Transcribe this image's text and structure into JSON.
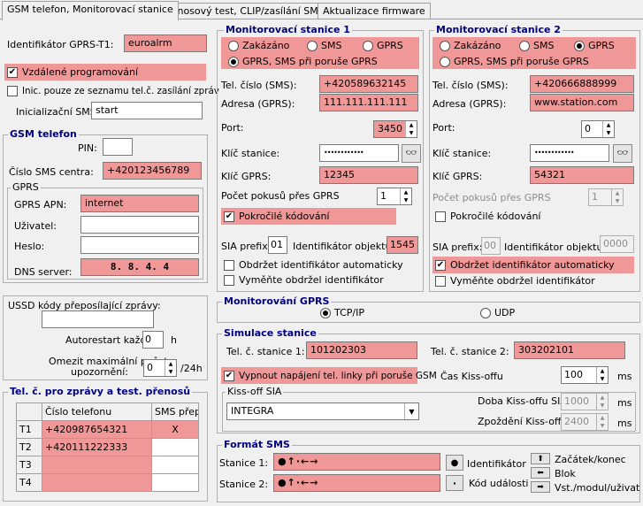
{
  "tabs": [
    {
      "label": "GSM telefon, Monitorovací stanice"
    },
    {
      "label": "Přenosový test, CLIP/zasílání SMS"
    },
    {
      "label": "Aktualizace firmware"
    }
  ],
  "gprs_id": {
    "label": "Identifikátor GPRS-T1:",
    "value": "euroalrm"
  },
  "remote_prog": {
    "label": "Vzdálené programování"
  },
  "init_only": {
    "label": "Inic. pouze ze seznamu tel.č. zasílání zpráv"
  },
  "init_sms": {
    "label": "Inicializační SMS:",
    "value": "start"
  },
  "gsm": {
    "title": "GSM telefon",
    "pin_label": "PIN:",
    "pin_value": "",
    "sms_center_label": "Číslo SMS centra:",
    "sms_center_value": "+420123456789",
    "gprs_title": "GPRS",
    "apn_label": "GPRS APN:",
    "apn_value": "internet",
    "user_label": "Uživatel:",
    "user_value": "",
    "pass_label": "Heslo:",
    "pass_value": "",
    "dns_label": "DNS server:",
    "dns_value": "8.  8.  4.  4"
  },
  "ussd": {
    "label": "USSD kódy přeposílající zprávy:",
    "value": ""
  },
  "autorestart": {
    "label": "Autorestart každé:",
    "value": "0",
    "unit": "h"
  },
  "omit": {
    "label1": "Omezit maximální počet",
    "label2": "upozornění:",
    "value": "0",
    "unit": "/24h"
  },
  "tel_table": {
    "title": "Tel. č. pro zprávy a test. přenosů",
    "headers": [
      "Číslo telefonu",
      "SMS přepo"
    ],
    "rows": [
      {
        "id": "T1",
        "number": "+420987654321",
        "sms": "X"
      },
      {
        "id": "T2",
        "number": "+420111222333",
        "sms": ""
      },
      {
        "id": "T3",
        "number": "",
        "sms": ""
      },
      {
        "id": "T4",
        "number": "",
        "sms": ""
      }
    ]
  },
  "ms1": {
    "title": "Monitorovací stanice 1",
    "opt_disabled": "Zakázáno",
    "opt_sms": "SMS",
    "opt_gprs": "GPRS",
    "opt_both": "GPRS, SMS při poruše GPRS",
    "tel_label": "Tel. číslo (SMS):",
    "tel_value": "+420589632145",
    "addr_label": "Adresa (GPRS):",
    "addr_value": "111.111.111.111",
    "port_label": "Port:",
    "port_value": "3450",
    "key_label": "Klíč stanice:",
    "key_value": "••••••••••••",
    "gkey_label": "Klíč GPRS:",
    "gkey_value": "12345",
    "attempts_label": "Počet pokusů přes GPRS",
    "attempts_value": "1",
    "adv_label": "Pokročilé kódování",
    "sia_label": "SIA prefix:",
    "sia_value": "01",
    "objid_label": "Identifikátor objektu",
    "objid_value": "1545",
    "auto_label": "Obdržet identifikátor automaticky",
    "replace_label": "Vyměňte obdržel identifikátor"
  },
  "ms2": {
    "title": "Monitorovací stanice 2",
    "opt_disabled": "Zakázáno",
    "opt_sms": "SMS",
    "opt_gprs": "GPRS",
    "opt_both": "GPRS, SMS při poruše GPRS",
    "tel_label": "Tel. číslo (SMS):",
    "tel_value": "+420666888999",
    "addr_label": "Adresa (GPRS):",
    "addr_value": "www.station.com",
    "port_label": "Port:",
    "port_value": "0",
    "key_label": "Klíč stanice:",
    "key_value": "••••••••••••",
    "gkey_label": "Klíč GPRS:",
    "gkey_value": "54321",
    "attempts_label": "Počet pokusů přes GPRS",
    "attempts_value": "1",
    "adv_label": "Pokročilé kódování",
    "sia_label": "SIA prefix:",
    "sia_value": "00",
    "objid_label": "Identifikátor objektu",
    "objid_value": "0000",
    "auto_label": "Obdržet identifikátor automaticky",
    "replace_label": "Vyměňte obdržel identifikátor"
  },
  "gprs_mon": {
    "title": "Monitorování GPRS",
    "tcp": "TCP/IP",
    "udp": "UDP"
  },
  "sim": {
    "title": "Simulace stanice",
    "st1_label": "Tel. č. stanice 1:",
    "st1_value": "101202303",
    "st2_label": "Tel. č. stanice 2:",
    "st2_value": "303202101",
    "cutoff_label": "Vypnout napájení tel. linky při poruše GSM",
    "kiss_label": "Čas Kiss-offu",
    "kiss_value": "100",
    "kiss_unit": "ms",
    "kisssia_title": "Kiss-off SIA",
    "kisssia_value": "INTEGRA",
    "dur_label": "Doba Kiss-offu SIA:",
    "dur_value": "1000",
    "dur_unit": "ms",
    "delay_label": "Zpoždění Kiss-offu:",
    "delay_value": "2400",
    "delay_unit": "ms"
  },
  "sms_format": {
    "title": "Formát SMS",
    "st1_label": "Stanice 1:",
    "st1_value": "●↑·←→",
    "st2_label": "Stanice 2:",
    "st2_value": "●↑·←→",
    "id_btn": "●",
    "id_label": "Identifikátor",
    "code_btn": "·",
    "code_label": "Kód události",
    "start_label": "Začátek/konec",
    "block_label": "Blok",
    "input_label": "Vst./modul/uživatel"
  }
}
